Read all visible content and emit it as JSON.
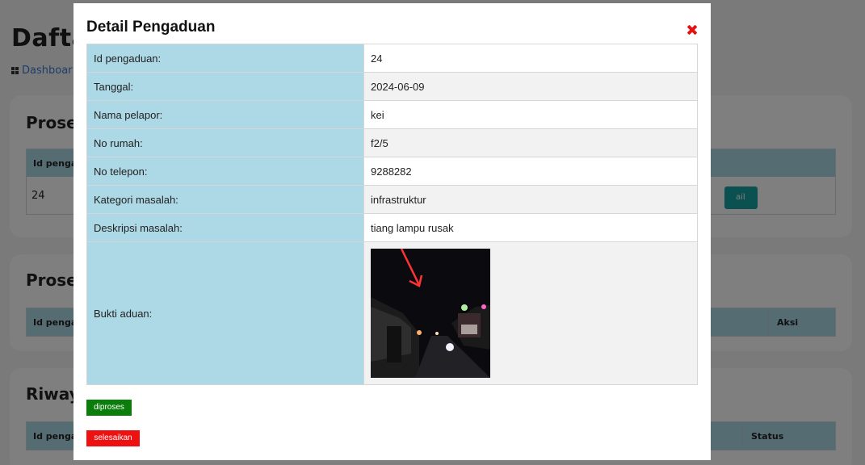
{
  "background": {
    "page_title": "Dafta",
    "breadcrumb": "Dashboar",
    "card1": {
      "title": "Proses",
      "header": "Id pengad",
      "cell": "24",
      "button": "ail"
    },
    "card2": {
      "title": "Proses",
      "header": "Id pengad",
      "aksi": "Aksi"
    },
    "card3": {
      "title": "Riway",
      "header": "Id pengad",
      "status": "Status"
    }
  },
  "modal": {
    "title": "Detail Pengaduan",
    "close_icon": "close-icon",
    "rows": [
      {
        "label": "Id pengaduan:",
        "value": "24"
      },
      {
        "label": "Tanggal:",
        "value": "2024-06-09"
      },
      {
        "label": "Nama pelapor:",
        "value": "kei"
      },
      {
        "label": "No rumah:",
        "value": "f2/5"
      },
      {
        "label": "No telepon:",
        "value": "9288282"
      },
      {
        "label": "Kategori masalah:",
        "value": "infrastruktur"
      },
      {
        "label": "Deskripsi masalah:",
        "value": "tiang lampu rusak"
      }
    ],
    "image_row": {
      "label": "Bukti aduan:",
      "image": "night-street-photo-with-red-arrow"
    },
    "buttons": {
      "process": "diproses",
      "finish": "selesaikan"
    }
  },
  "colors": {
    "label_bg": "#add8e6",
    "process_button": "#0a7d0a",
    "finish_button": "#ee1111",
    "close_icon": "#e41313"
  }
}
